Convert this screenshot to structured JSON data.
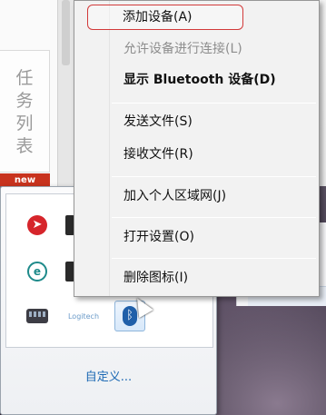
{
  "background": {
    "task_panel_chars": [
      "任",
      "务",
      "列",
      "表"
    ],
    "new_badge": "new"
  },
  "tray": {
    "icons": [
      {
        "name": "red-app-icon",
        "glyph": "➤"
      },
      {
        "name": "eset-icon",
        "glyph": "e"
      },
      {
        "name": "keyboard-icon"
      },
      {
        "name": "logitech-icon",
        "glyph": "Logitech"
      },
      {
        "name": "bluetooth-icon",
        "glyph": "ᛒ"
      }
    ],
    "customize_link": "自定义..."
  },
  "context_menu": {
    "items": [
      {
        "label": "添加设备(A)",
        "state": "focused"
      },
      {
        "label": "允许设备进行连接(L)",
        "state": "disabled"
      },
      {
        "label": "显示 Bluetooth 设备(D)",
        "state": "default-bold"
      },
      {
        "label": "发送文件(S)"
      },
      {
        "label": "接收文件(R)"
      },
      {
        "label": "加入个人区域网(J)"
      },
      {
        "label": "打开设置(O)"
      },
      {
        "label": "删除图标(I)"
      }
    ]
  }
}
